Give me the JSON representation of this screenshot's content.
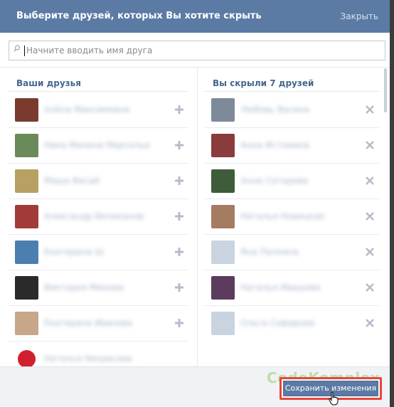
{
  "dialog": {
    "title": "Выберите друзей, которых Вы хотите скрыть",
    "close_label": "Закрыть"
  },
  "search": {
    "placeholder": "Начните вводить имя друга",
    "value": ""
  },
  "left_column": {
    "heading": "Ваши друзья",
    "items": [
      {
        "name": "Алёна Максимовна",
        "avatar_color": "#7a3b2e"
      },
      {
        "name": "Ника Милена Марсельевна",
        "avatar_color": "#6b8a5a"
      },
      {
        "name": "Маша Висай",
        "avatar_color": "#b8a062"
      },
      {
        "name": "Александр Великанов",
        "avatar_color": "#a33a3a"
      },
      {
        "name": "Екатерина Ш",
        "avatar_color": "#4c7fb0"
      },
      {
        "name": "Виктория Минова",
        "avatar_color": "#2a2a2a"
      },
      {
        "name": "Екатерина Иванова",
        "avatar_color": "#c7a68a"
      },
      {
        "name": "Наталья Некрасова",
        "avatar_color": "#d01f2f"
      }
    ]
  },
  "right_column": {
    "heading": "Вы скрыли 7 друзей",
    "items": [
      {
        "name": "Любовь Васина",
        "avatar_color": "#7e8a9a"
      },
      {
        "name": "Анна Истомина",
        "avatar_color": "#8a3c3c"
      },
      {
        "name": "Анна Ситарева",
        "avatar_color": "#3e5c3a"
      },
      {
        "name": "Наталья Новицкая",
        "avatar_color": "#a57b62"
      },
      {
        "name": "Яна Палкина",
        "avatar_color": "#c9d4e0"
      },
      {
        "name": "Наталья Ивашова",
        "avatar_color": "#5b3b5e"
      },
      {
        "name": "Ольга Сафарова",
        "avatar_color": "#c9d4e0"
      }
    ]
  },
  "footer": {
    "save_label": "Сохранить изменения",
    "watermark": "CodeKomplex"
  },
  "colors": {
    "header": "#5b7ba5",
    "heading_text": "#45688e",
    "highlight": "#e8453c"
  }
}
